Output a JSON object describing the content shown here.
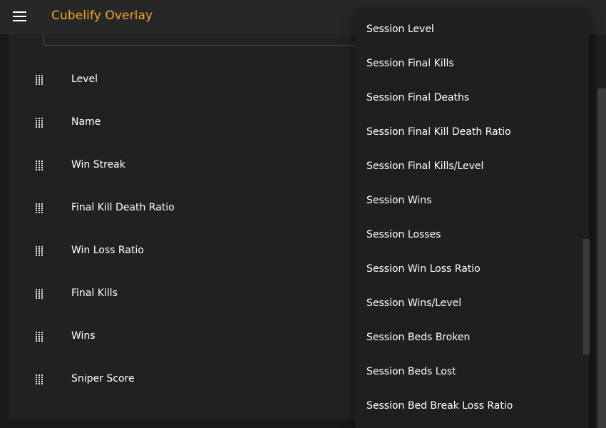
{
  "app": {
    "title": "Cubelify Overlay",
    "accent_color": "#f5a623"
  },
  "columns": [
    {
      "label": "Level",
      "handle_icon": "drag-handle-icon"
    },
    {
      "label": "Name",
      "handle_icon": "drag-handle-icon"
    },
    {
      "label": "Win Streak",
      "handle_icon": "drag-handle-icon"
    },
    {
      "label": "Final Kill Death Ratio",
      "handle_icon": "drag-handle-icon"
    },
    {
      "label": "Win Loss Ratio",
      "handle_icon": "drag-handle-icon"
    },
    {
      "label": "Final Kills",
      "handle_icon": "drag-handle-icon"
    },
    {
      "label": "Wins",
      "handle_icon": "drag-handle-icon"
    },
    {
      "label": "Sniper Score",
      "handle_icon": "drag-handle-icon"
    }
  ],
  "dropdown": {
    "items": [
      "Session Level",
      "Session Final Kills",
      "Session Final Deaths",
      "Session Final Kill Death Ratio",
      "Session Final Kills/Level",
      "Session Wins",
      "Session Losses",
      "Session Win Loss Ratio",
      "Session Wins/Level",
      "Session Beds Broken",
      "Session Beds Lost",
      "Session Bed Break Loss Ratio"
    ]
  },
  "icons": {
    "menu": "hamburger-menu-icon",
    "handle": "drag-handle-icon"
  }
}
